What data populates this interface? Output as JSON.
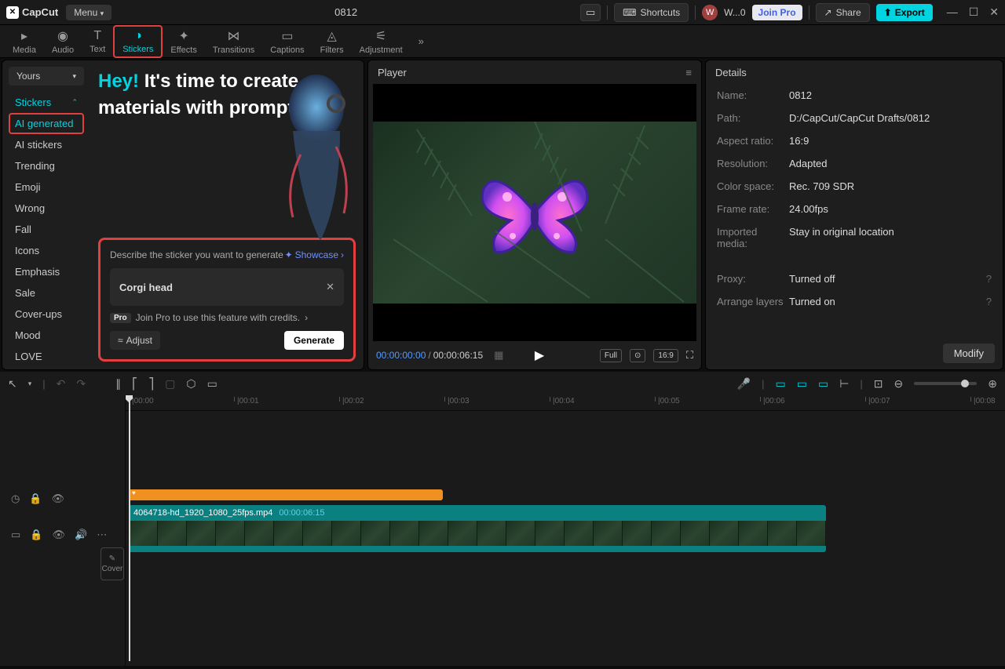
{
  "titlebar": {
    "brand": "CapCut",
    "menu": "Menu",
    "title": "0812",
    "shortcuts": "Shortcuts",
    "profile": "W...0",
    "avatar_letter": "W",
    "join_pro": "Join Pro",
    "share": "Share",
    "export": "Export"
  },
  "tabs": {
    "media": "Media",
    "audio": "Audio",
    "text": "Text",
    "stickers": "Stickers",
    "effects": "Effects",
    "transitions": "Transitions",
    "captions": "Captions",
    "filters": "Filters",
    "adjustment": "Adjustment"
  },
  "sidebar": {
    "yours": "Yours",
    "header": "Stickers",
    "items": [
      "AI generated",
      "AI stickers",
      "Trending",
      "Emoji",
      "Wrong",
      "Fall",
      "Icons",
      "Emphasis",
      "Sale",
      "Cover-ups",
      "Mood",
      "LOVE"
    ]
  },
  "hero": {
    "hey": "Hey!",
    "text": " It's time to create materials with prompt."
  },
  "generate": {
    "label": "Describe the sticker you want to generate",
    "showcase": "Showcase",
    "input_value": "Corgi head",
    "pro_badge": "Pro",
    "pro_text": "Join Pro to use this feature with credits.",
    "adjust": "Adjust",
    "generate": "Generate"
  },
  "player": {
    "title": "Player",
    "current_time": "00:00:00:00",
    "total_time": "00:00:06:15",
    "full": "Full",
    "ratio": "16:9"
  },
  "details": {
    "title": "Details",
    "rows": [
      {
        "label": "Name:",
        "value": "0812"
      },
      {
        "label": "Path:",
        "value": "D:/CapCut/CapCut Drafts/0812"
      },
      {
        "label": "Aspect ratio:",
        "value": "16:9"
      },
      {
        "label": "Resolution:",
        "value": "Adapted"
      },
      {
        "label": "Color space:",
        "value": "Rec. 709 SDR"
      },
      {
        "label": "Frame rate:",
        "value": "24.00fps"
      },
      {
        "label": "Imported media:",
        "value": "Stay in original location"
      }
    ],
    "rows2": [
      {
        "label": "Proxy:",
        "value": "Turned off",
        "help": true
      },
      {
        "label": "Arrange layers",
        "value": "Turned on",
        "help": true
      }
    ],
    "modify": "Modify"
  },
  "timeline": {
    "ruler": [
      "|00:00",
      "|00:01",
      "|00:02",
      "|00:03",
      "|00:04",
      "|00:05",
      "|00:06",
      "|00:07",
      "|00:08"
    ],
    "clip_name": "4064718-hd_1920_1080_25fps.mp4",
    "clip_duration": "00:00:06:15",
    "cover": "Cover"
  }
}
